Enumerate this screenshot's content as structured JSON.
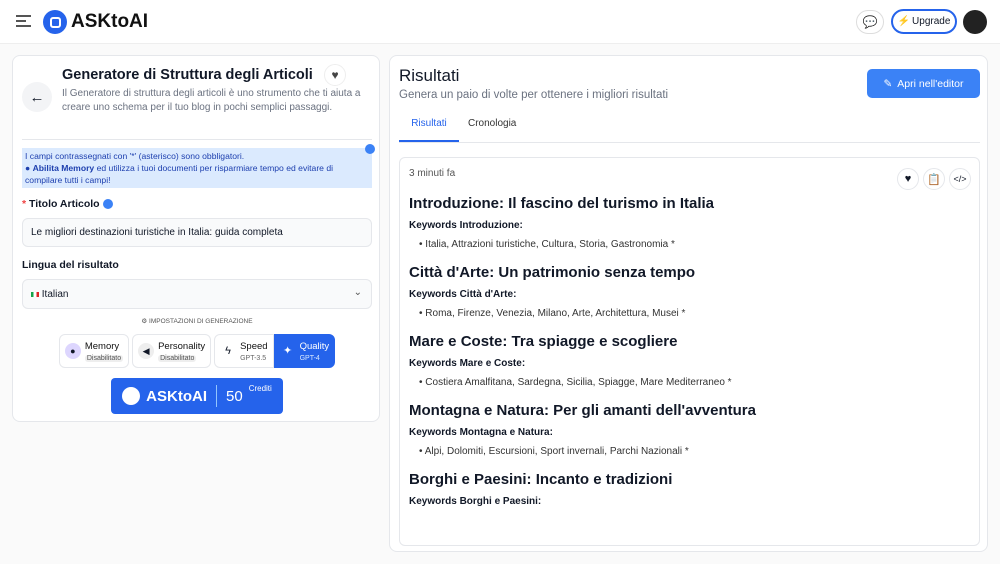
{
  "header": {
    "logo": "ASKtoAI",
    "upgrade": "Upgrade"
  },
  "left": {
    "title": "Generatore di Struttura degli Articoli",
    "description": "Il Generatore di struttura degli articoli è uno strumento che ti aiuta a creare uno schema per il tuo blog in pochi semplici passaggi.",
    "notice_line1": "I campi contrassegnati con '*' (asterisco) sono obbligatori.",
    "notice_bold": "Abilita Memory",
    "notice_rest": " ed utilizza i tuoi documenti per risparmiare tempo ed evitare di compilare tutti i campi!",
    "title_label": "Titolo Articolo",
    "title_value": "Le migliori destinazioni turistiche in Italia: guida completa",
    "lang_label": "Lingua del risultato",
    "lang_value": "Italian",
    "settings_label": "IMPOSTAZIONI DI GENERAZIONE",
    "options": [
      {
        "label": "Memory",
        "sub": "Disabilitato"
      },
      {
        "label": "Personality",
        "sub": "Disabilitato"
      },
      {
        "label": "Speed",
        "sub": "GPT-3.5"
      },
      {
        "label": "Quality",
        "sub": "GPT-4",
        "selected": true
      }
    ],
    "submit_logo": "ASKtoAI",
    "credits": "50",
    "credits_label": "Crediti"
  },
  "right": {
    "title": "Risultati",
    "subtitle": "Genera un paio di volte per ottenere i migliori risultati",
    "editor_button": "Apri nell'editor",
    "tabs": [
      "Risultati",
      "Cronologia"
    ],
    "time": "3 minuti fa",
    "sections": [
      {
        "h": "Introduzione: Il fascino del turismo in Italia",
        "k": "Keywords Introduzione:",
        "v": "Italia, Attrazioni turistiche, Cultura, Storia, Gastronomia *"
      },
      {
        "h": "Città d'Arte: Un patrimonio senza tempo",
        "k": "Keywords Città d'Arte:",
        "v": "Roma, Firenze, Venezia, Milano, Arte, Architettura, Musei *"
      },
      {
        "h": "Mare e Coste: Tra spiagge e scogliere",
        "k": "Keywords Mare e Coste:",
        "v": "Costiera Amalfitana, Sardegna, Sicilia, Spiagge, Mare Mediterraneo *"
      },
      {
        "h": "Montagna e Natura: Per gli amanti dell'avventura",
        "k": "Keywords Montagna e Natura:",
        "v": "Alpi, Dolomiti, Escursioni, Sport invernali, Parchi Nazionali *"
      },
      {
        "h": "Borghi e Paesini: Incanto e tradizioni",
        "k": "Keywords Borghi e Paesini:"
      }
    ]
  },
  "colors": {
    "accent": "#2563eb",
    "notice_bg": "#dbeafe"
  }
}
